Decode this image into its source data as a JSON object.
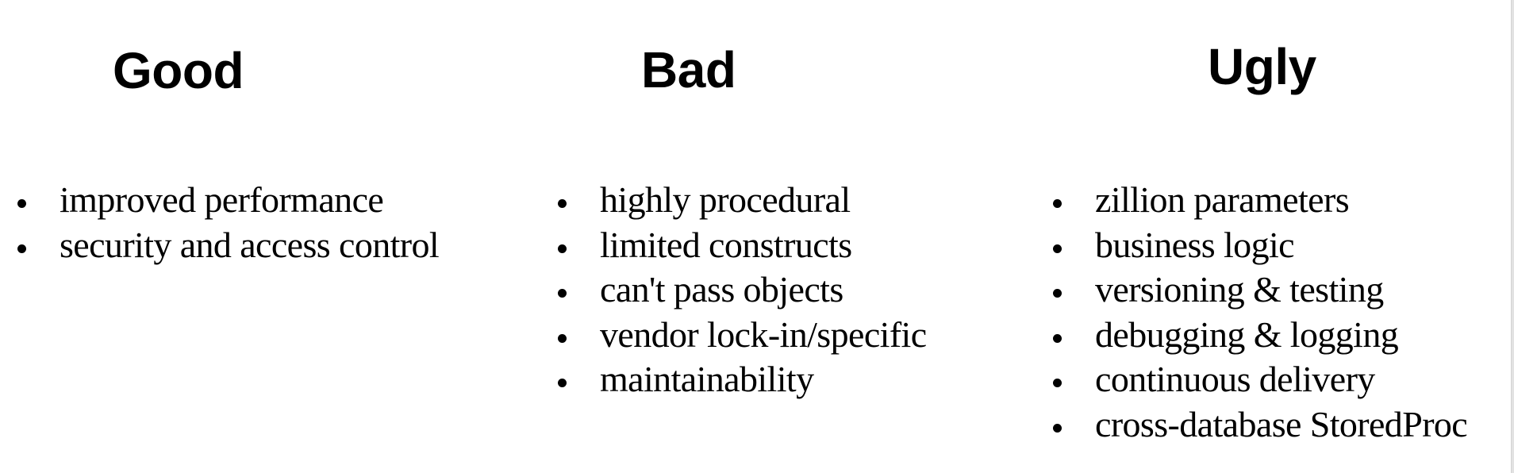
{
  "columns": [
    {
      "heading": "Good",
      "items": [
        "improved performance",
        "security and access control"
      ]
    },
    {
      "heading": "Bad",
      "items": [
        "highly procedural",
        "limited constructs",
        "can't pass objects",
        "vendor lock-in/specific",
        "maintainability"
      ]
    },
    {
      "heading": "Ugly",
      "items": [
        "zillion parameters",
        "business logic",
        "versioning & testing",
        "debugging & logging",
        "continuous delivery",
        "cross-database StoredProc"
      ]
    }
  ],
  "icons": {
    "bullet": "bullet-dot-icon"
  }
}
